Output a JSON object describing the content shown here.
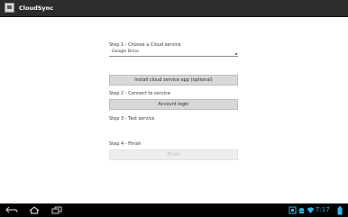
{
  "app": {
    "title": "CloudSync"
  },
  "steps": {
    "step1": {
      "label": "Step 1 - Choose a Cloud service",
      "service_select": "Google Drive",
      "install_button": "Install cloud service app (optional)"
    },
    "step2": {
      "label": "Step 2 - Connect to service",
      "login_button": "Account login"
    },
    "step3": {
      "label": "Step 3 - Test service"
    },
    "step4": {
      "label": "Step 4 - Finish",
      "finish_button": "Finish"
    }
  },
  "navbar": {
    "icons": [
      "back-icon",
      "home-icon",
      "recent-apps-icon",
      "screenshot-icon",
      "android-icon",
      "wifi-icon",
      "battery-icon"
    ],
    "clock": "7:17",
    "accent": "#33b5e5"
  }
}
